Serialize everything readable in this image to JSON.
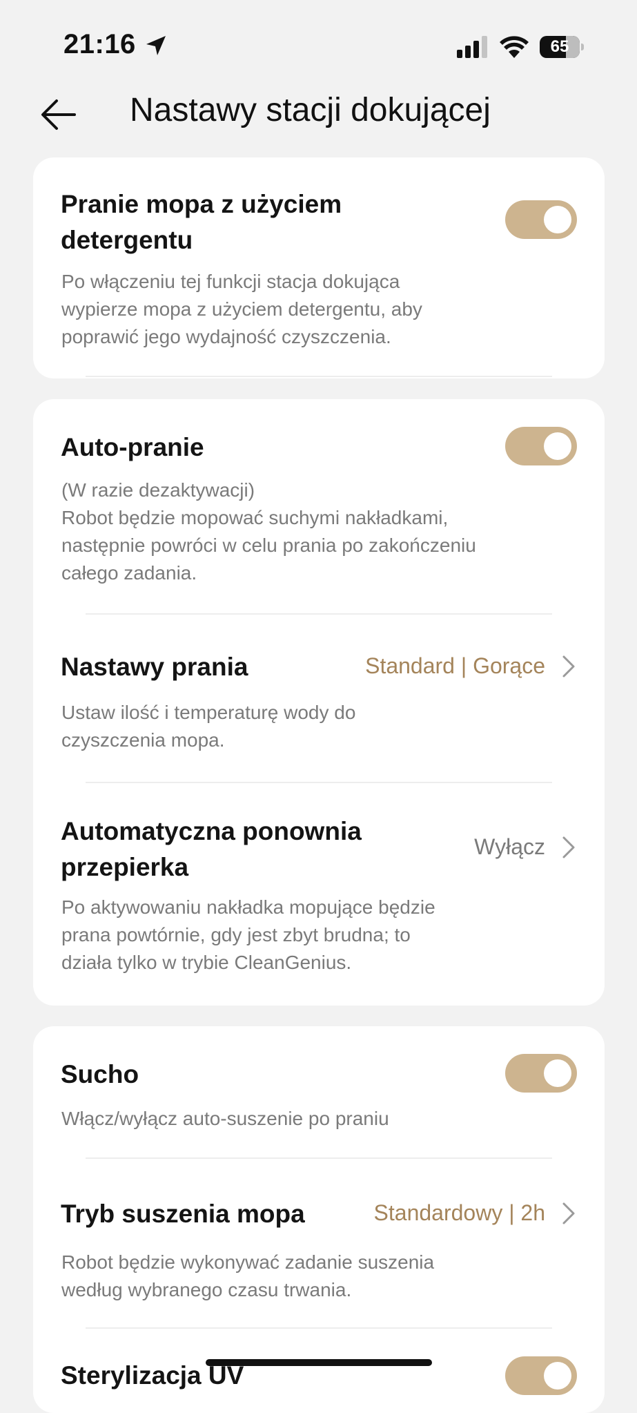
{
  "status_bar": {
    "time": "21:16",
    "battery": "65",
    "icons": [
      "location-arrow-icon",
      "cellular-signal-icon",
      "wifi-icon",
      "battery-icon"
    ]
  },
  "header": {
    "title": "Nastawy stacji dokującej",
    "back_icon": "back-arrow-icon"
  },
  "cards": {
    "detergent": {
      "title_line1": "Pranie mopa z użyciem",
      "title_line2": "detergentu",
      "toggle_on": true,
      "desc_line1": "Po włączeniu tej funkcji stacja dokująca",
      "desc_line2": "wypierze mopa z użyciem detergentu, aby",
      "desc_line3": "poprawić jego wydajność czyszczenia."
    },
    "washing": {
      "auto_wash": {
        "title": "Auto-pranie",
        "toggle_on": true,
        "desc_line1": "(W razie dezaktywacji)",
        "desc_line2": "Robot będzie mopować suchymi nakładkami,",
        "desc_line3": "następnie powróci w celu prania po zakończeniu",
        "desc_line4": "całego zadania."
      },
      "wash_settings": {
        "title": "Nastawy prania",
        "value": "Standard | Gorące",
        "desc_line1": "Ustaw ilość i temperaturę wody do",
        "desc_line2": "czyszczenia mopa."
      },
      "rewash": {
        "title_line1": "Automatyczna ponownia",
        "title_line2": "przepierka",
        "value": "Wyłącz",
        "desc_line1": "Po aktywowaniu nakładka mopujące będzie",
        "desc_line2": "prana powtórnie, gdy jest zbyt brudna; to",
        "desc_line3": "działa tylko w trybie CleanGenius."
      }
    },
    "drying": {
      "dry": {
        "title": "Sucho",
        "toggle_on": true,
        "desc_line1": "Włącz/wyłącz auto-suszenie po praniu"
      },
      "dry_mode": {
        "title": "Tryb suszenia mopa",
        "value": "Standardowy | 2h",
        "desc_line1": "Robot będzie wykonywać zadanie suszenia",
        "desc_line2": "według wybranego czasu trwania."
      },
      "uv": {
        "title": "Sterylizacja UV",
        "toggle_on": true
      }
    }
  },
  "colors": {
    "accent": "#cdb48f",
    "value_text": "#a4845a",
    "background": "#f2f2f2"
  }
}
